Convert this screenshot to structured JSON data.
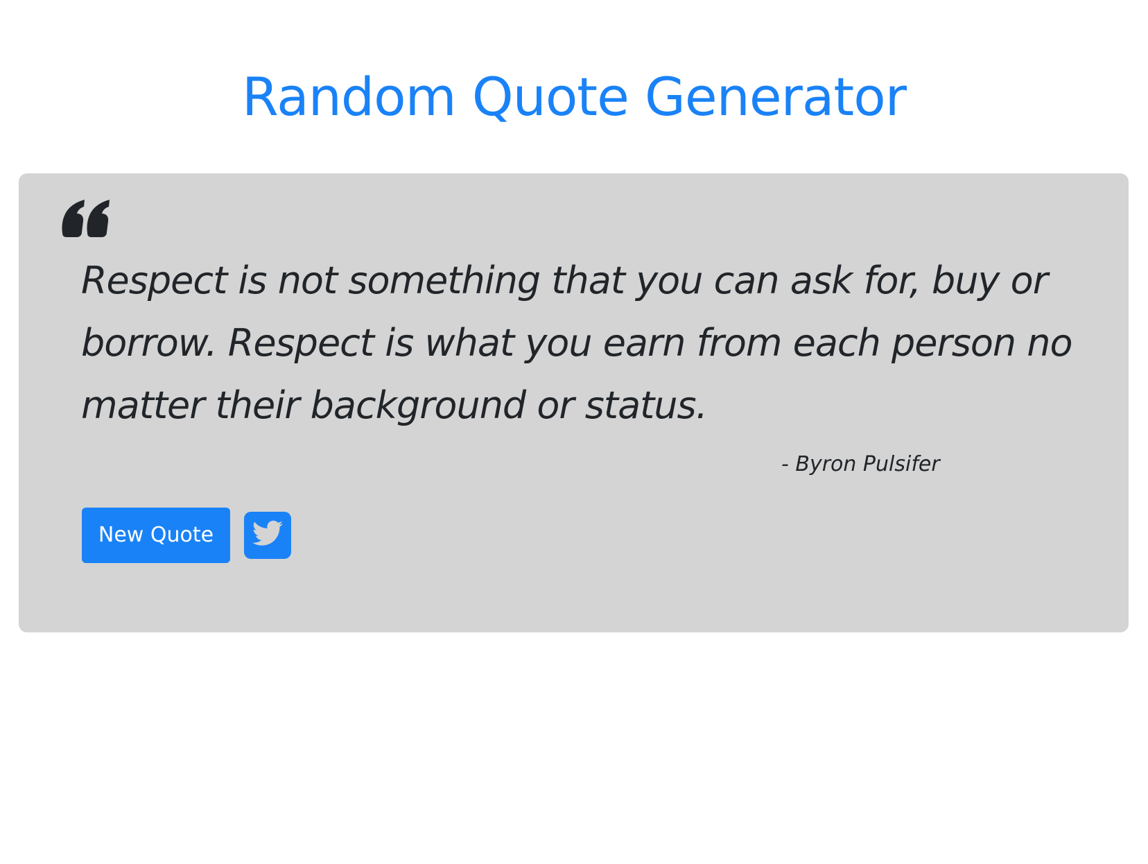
{
  "header": {
    "title": "Random Quote Generator"
  },
  "quote": {
    "text": "Respect is not something that you can ask for, buy or borrow. Respect is what you earn from each person no matter their background or status.",
    "author": "- Byron Pulsifer",
    "icon": "quote-left-icon"
  },
  "actions": {
    "new_quote_label": "New Quote",
    "tweet_icon": "twitter-icon"
  },
  "colors": {
    "accent": "#1a82f7",
    "card_background": "#d4d4d4",
    "text": "#212529"
  }
}
